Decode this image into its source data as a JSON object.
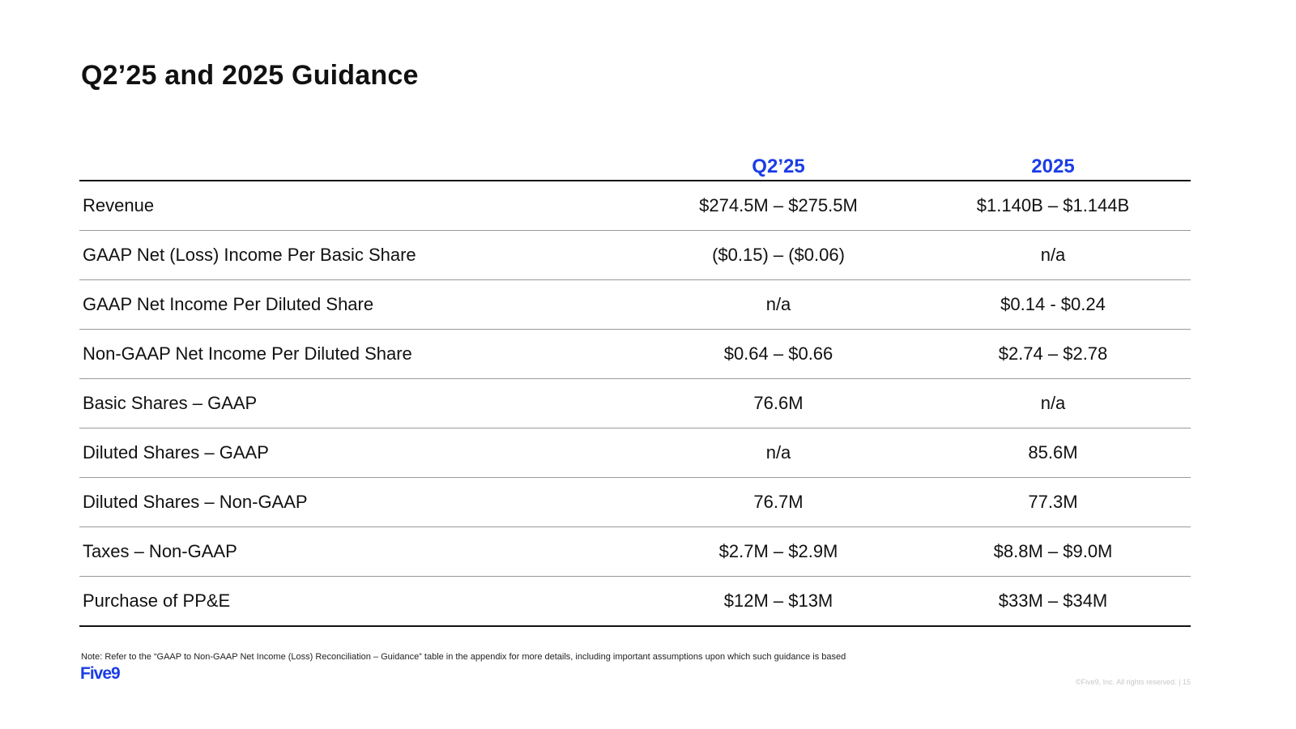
{
  "title": "Q2’25 and 2025 Guidance",
  "table": {
    "columns": [
      "Q2’25",
      "2025"
    ],
    "rows": [
      {
        "label": "Revenue",
        "q2": "$274.5M – $275.5M",
        "fy": "$1.140B – $1.144B"
      },
      {
        "label": "GAAP Net (Loss) Income Per Basic Share",
        "q2": "($0.15) – ($0.06)",
        "fy": "n/a"
      },
      {
        "label": "GAAP Net Income Per Diluted Share",
        "q2": "n/a",
        "fy": "$0.14 - $0.24"
      },
      {
        "label": "Non-GAAP Net Income Per Diluted Share",
        "q2": "$0.64 – $0.66",
        "fy": "$2.74 – $2.78"
      },
      {
        "label": "Basic Shares – GAAP",
        "q2": "76.6M",
        "fy": "n/a"
      },
      {
        "label": "Diluted Shares – GAAP",
        "q2": "n/a",
        "fy": "85.6M"
      },
      {
        "label": "Diluted Shares – Non-GAAP",
        "q2": "76.7M",
        "fy": "77.3M"
      },
      {
        "label": "Taxes – Non-GAAP",
        "q2": "$2.7M – $2.9M",
        "fy": "$8.8M – $9.0M"
      },
      {
        "label": "Purchase of PP&E",
        "q2": "$12M – $13M",
        "fy": "$33M – $34M"
      }
    ]
  },
  "note": "Note: Refer to the “GAAP to Non-GAAP Net Income (Loss) Reconciliation – Guidance” table in the appendix for more details, including important assumptions upon which such guidance is based",
  "logo": "Five9",
  "footer": "©Five9, Inc. All rights reserved. | 15",
  "colors": {
    "accent": "#1a3de6",
    "text": "#111111"
  }
}
